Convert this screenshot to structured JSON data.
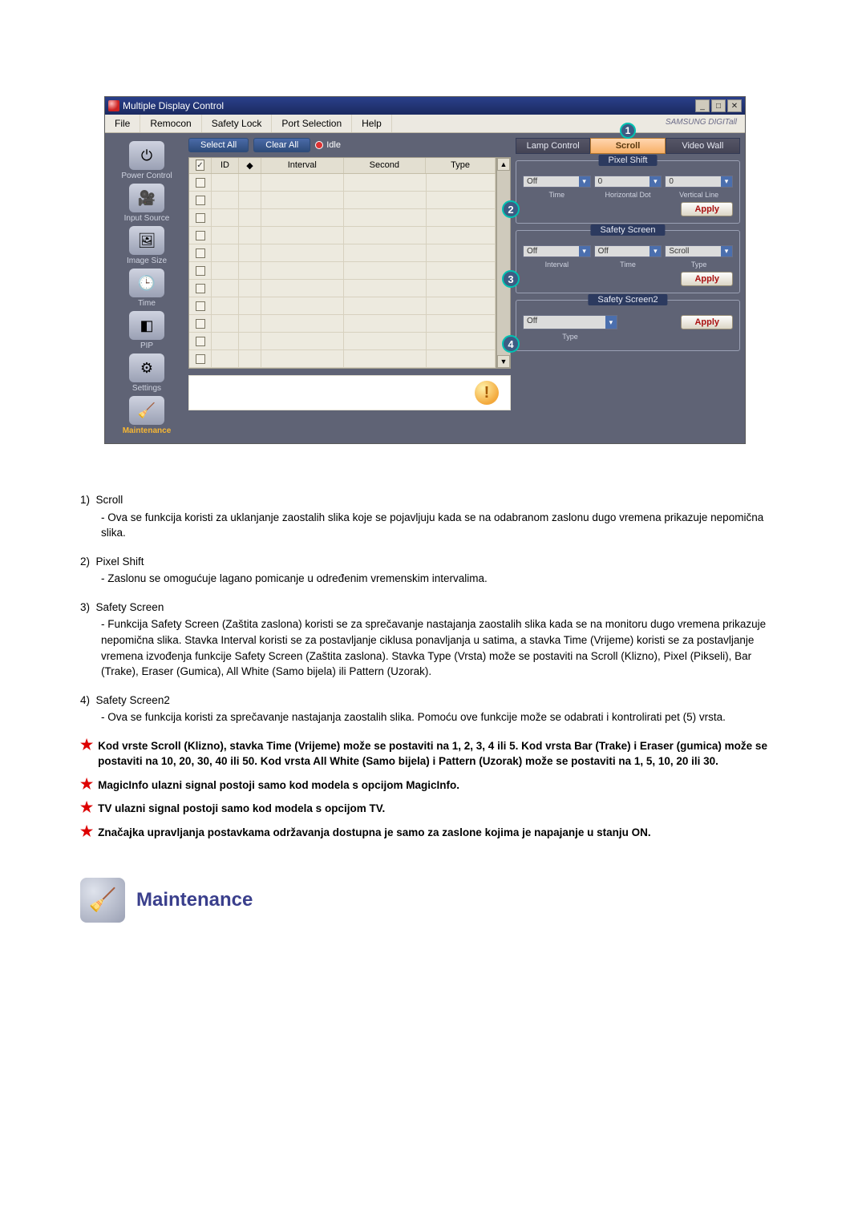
{
  "app": {
    "title": "Multiple Display Control",
    "menubar": [
      "File",
      "Remocon",
      "Safety Lock",
      "Port Selection",
      "Help"
    ],
    "brand": "SAMSUNG DIGITall"
  },
  "sidebar": [
    {
      "label": "Power Control",
      "glyph": "⏻"
    },
    {
      "label": "Input Source",
      "glyph": "🎥"
    },
    {
      "label": "Image Size",
      "glyph": "🖼"
    },
    {
      "label": "Time",
      "glyph": "🕒"
    },
    {
      "label": "PIP",
      "glyph": "◧"
    },
    {
      "label": "Settings",
      "glyph": "⚙"
    },
    {
      "label": "Maintenance",
      "glyph": "🧹",
      "active": true
    }
  ],
  "toolbar": {
    "select_all": "Select All",
    "clear_all": "Clear All",
    "idle": "Idle"
  },
  "table": {
    "headers": {
      "ck": "",
      "id": "ID",
      "status": "",
      "interval": "Interval",
      "second": "Second",
      "type": "Type"
    },
    "rows": [
      {
        "checked": true
      },
      {
        "checked": false
      },
      {
        "checked": false
      },
      {
        "checked": false
      },
      {
        "checked": false
      },
      {
        "checked": false
      },
      {
        "checked": false
      },
      {
        "checked": false
      },
      {
        "checked": false
      },
      {
        "checked": false
      },
      {
        "checked": false
      }
    ]
  },
  "rtabs": {
    "lamp": "Lamp Control",
    "scroll": "Scroll",
    "video": "Video Wall"
  },
  "panels": {
    "pixel_shift": {
      "legend": "Pixel Shift",
      "fields": {
        "time": {
          "value": "Off",
          "label": "Time"
        },
        "hdot": {
          "value": "0",
          "label": "Horizontal Dot"
        },
        "vline": {
          "value": "0",
          "label": "Vertical Line"
        }
      },
      "apply": "Apply",
      "callout": "2"
    },
    "safety_screen": {
      "legend": "Safety Screen",
      "fields": {
        "interval": {
          "value": "Off",
          "label": "Interval"
        },
        "time": {
          "value": "Off",
          "label": "Time"
        },
        "type": {
          "value": "Scroll",
          "label": "Type"
        }
      },
      "apply": "Apply",
      "callout": "3"
    },
    "safety_screen2": {
      "legend": "Safety Screen2",
      "fields": {
        "type": {
          "value": "Off",
          "label": "Type"
        }
      },
      "apply": "Apply",
      "callout": "4"
    }
  },
  "scroll_callout": "1",
  "doc": {
    "items": [
      {
        "num": "1)",
        "title": "Scroll",
        "body": "- Ova se funkcija koristi za uklanjanje zaostalih slika koje se pojavljuju kada se na odabranom zaslonu dugo vremena prikazuje nepomična slika."
      },
      {
        "num": "2)",
        "title": "Pixel Shift",
        "body": "- Zaslonu se omogućuje lagano pomicanje u određenim vremenskim intervalima."
      },
      {
        "num": "3)",
        "title": "Safety Screen",
        "body": "- Funkcija Safety Screen (Zaštita zaslona) koristi se za sprečavanje nastajanja zaostalih slika kada se na monitoru dugo vremena prikazuje nepomična slika.  Stavka Interval koristi se za postavljanje ciklusa ponavljanja u satima, a stavka Time (Vrijeme) koristi se za postavljanje vremena izvođenja funkcije Safety Screen (Zaštita zaslona). Stavka Type (Vrsta) može se postaviti na Scroll (Klizno), Pixel (Pikseli), Bar (Trake), Eraser (Gumica), All White (Samo bijela) ili Pattern (Uzorak)."
      },
      {
        "num": "4)",
        "title": "Safety Screen2",
        "body": "- Ova se funkcija koristi za sprečavanje nastajanja zaostalih slika. Pomoću ove funkcije može se odabrati i kontrolirati pet (5) vrsta."
      }
    ],
    "notes": [
      "Kod vrste Scroll (Klizno), stavka Time (Vrijeme) može se postaviti na 1, 2, 3, 4 ili 5. Kod vrsta Bar (Trake) i Eraser (gumica) može se postaviti na 10, 20, 30, 40 ili 50. Kod vrsta All White (Samo bijela) i Pattern (Uzorak) može se postaviti na 1, 5, 10, 20 ili 30.",
      "MagicInfo ulazni signal postoji samo kod modela s opcijom MagicInfo.",
      "TV ulazni signal postoji samo kod modela s opcijom TV.",
      "Značajka upravljanja postavkama održavanja dostupna je samo za zaslone kojima je napajanje u stanju ON."
    ],
    "heading": "Maintenance"
  }
}
